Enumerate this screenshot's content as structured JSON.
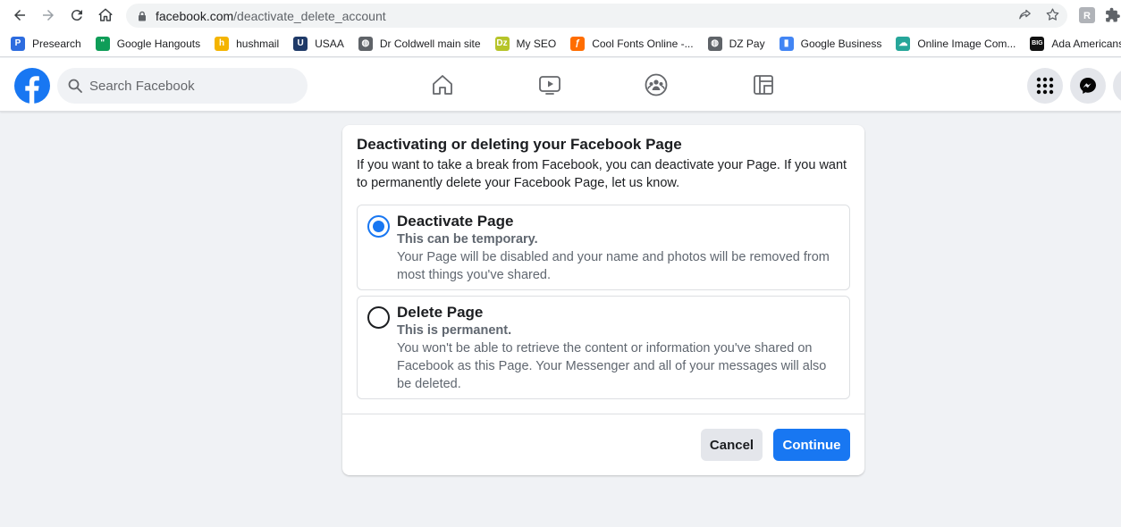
{
  "browser": {
    "url_domain": "facebook.com",
    "url_path": "/deactivate_delete_account",
    "bookmarks": [
      {
        "label": "Presearch",
        "icon": "presearch-icon",
        "color": "#2d6cdf",
        "glyph": "P"
      },
      {
        "label": "Google Hangouts",
        "icon": "hangouts-icon",
        "color": "#0f9d58",
        "glyph": "\""
      },
      {
        "label": "hushmail",
        "icon": "hushmail-icon",
        "color": "#f4b400",
        "glyph": "h"
      },
      {
        "label": "USAA",
        "icon": "usaa-icon",
        "color": "#1f3a68",
        "glyph": "U"
      },
      {
        "label": "Dr Coldwell main site",
        "icon": "globe-icon",
        "color": "#5f6368",
        "glyph": "◍"
      },
      {
        "label": "My SEO",
        "icon": "myseo-icon",
        "color": "#b6c429",
        "glyph": "Dz"
      },
      {
        "label": "Cool Fonts Online -...",
        "icon": "coolfonts-icon",
        "color": "#ff6d00",
        "glyph": "ƒ"
      },
      {
        "label": "DZ Pay",
        "icon": "globe-icon",
        "color": "#5f6368",
        "glyph": "◍"
      },
      {
        "label": "Google Business",
        "icon": "google-business-icon",
        "color": "#4285f4",
        "glyph": "▮"
      },
      {
        "label": "Online Image Com...",
        "icon": "image-compressor-icon",
        "color": "#26a69a",
        "glyph": "☁"
      },
      {
        "label": "Ada Americans Ve",
        "icon": "big-icon",
        "color": "#111111",
        "glyph": "BIG"
      }
    ]
  },
  "facebook": {
    "search_placeholder": "Search Facebook",
    "brand_color": "#1877f2"
  },
  "dialog": {
    "title": "Deactivating or deleting your Facebook Page",
    "description": "If you want to take a break from Facebook, you can deactivate your Page. If you want to permanently delete your Facebook Page, let us know.",
    "options": [
      {
        "title": "Deactivate Page",
        "subtitle": "This can be temporary.",
        "body": "Your Page will be disabled and your name and photos will be removed from most things you've shared.",
        "selected": true
      },
      {
        "title": "Delete Page",
        "subtitle": "This is permanent.",
        "body": "You won't be able to retrieve the content or information you've shared on Facebook as this Page. Your Messenger and all of your messages will also be deleted.",
        "selected": false
      }
    ],
    "cancel_label": "Cancel",
    "continue_label": "Continue"
  }
}
